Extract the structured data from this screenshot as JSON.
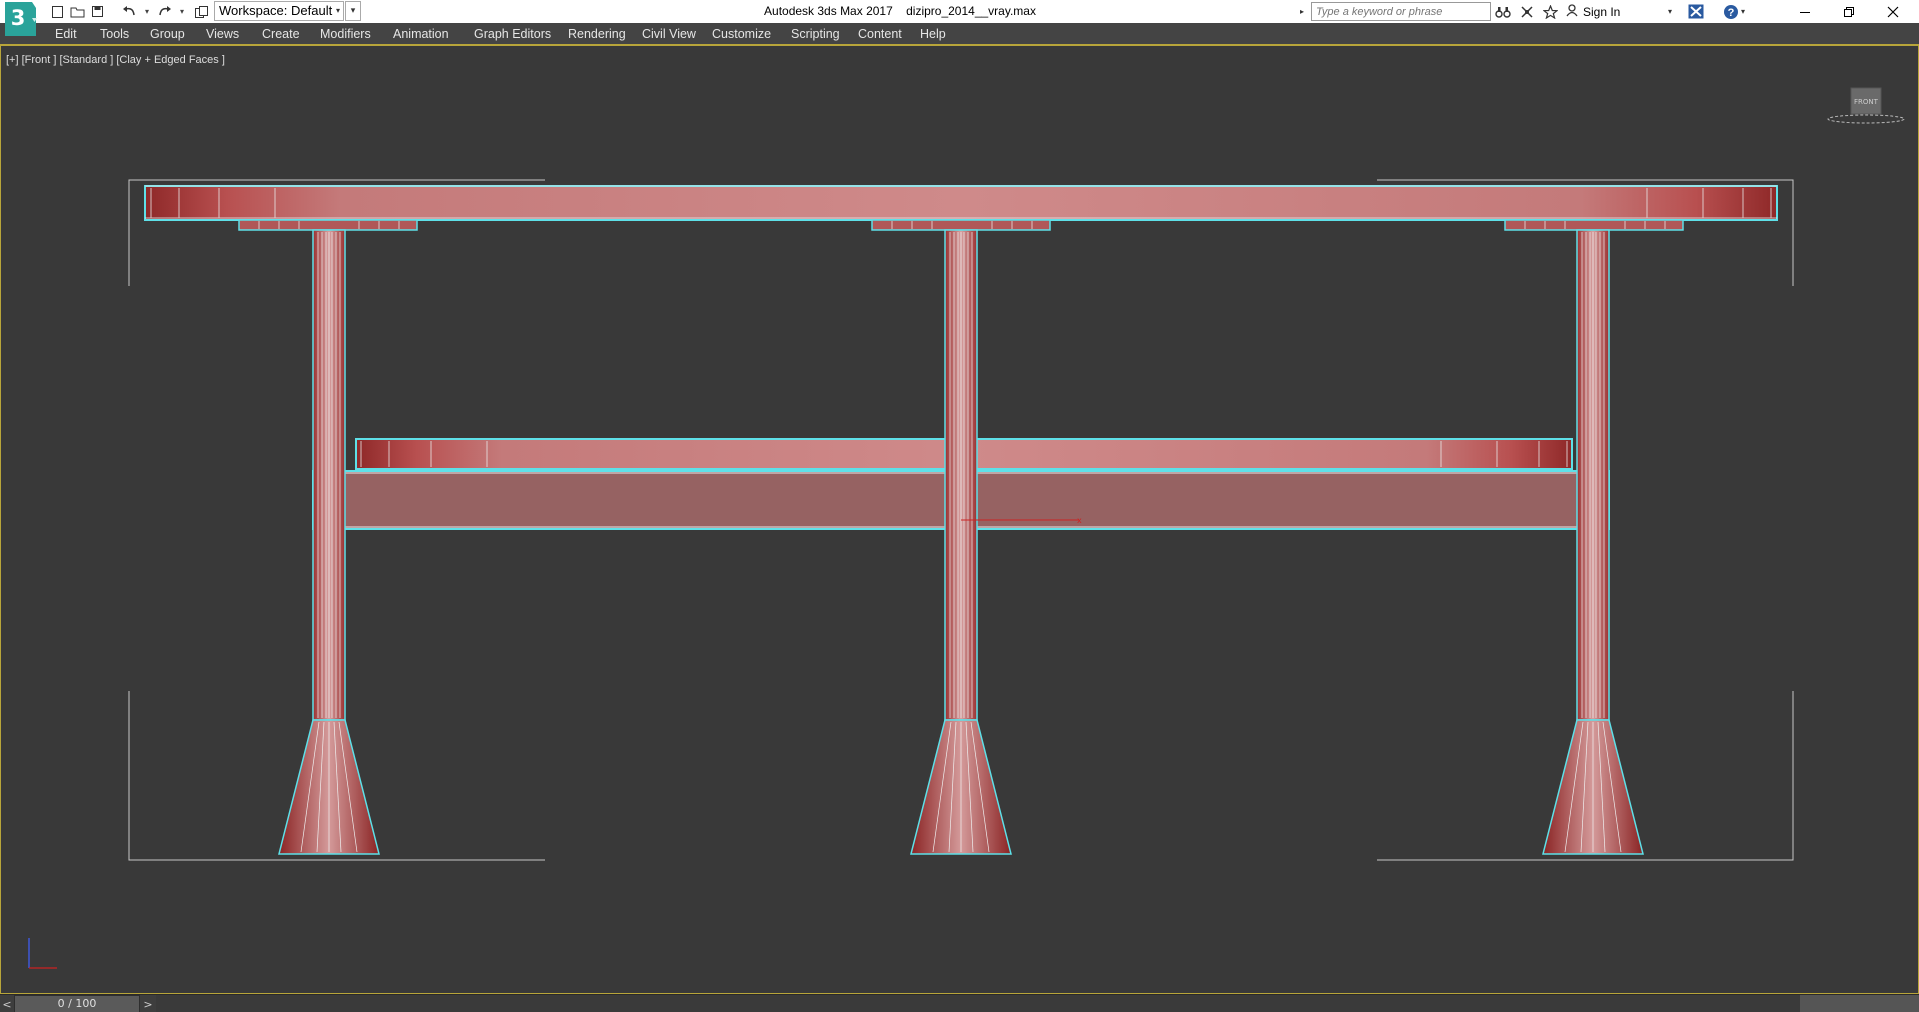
{
  "titlebar": {
    "app_name": "Autodesk 3ds Max 2017",
    "file_name": "dizipro_2014__vray.max",
    "logo_icon": "3ds-max-logo-icon",
    "logo_text": "3",
    "workspace_label": "Workspace: Default",
    "search_placeholder": "Type a keyword or phrase",
    "signin_label": "Sign In"
  },
  "quick_access": [
    {
      "name": "new-file-icon",
      "glyph": "□"
    },
    {
      "name": "open-folder-icon",
      "glyph": "⊏"
    },
    {
      "name": "save-icon",
      "glyph": "▣"
    },
    {
      "name": "undo-icon",
      "glyph": "↶"
    },
    {
      "name": "redo-icon",
      "glyph": "↷"
    },
    {
      "name": "project-folder-icon",
      "glyph": "⧉"
    }
  ],
  "menu": [
    "Edit",
    "Tools",
    "Group",
    "Views",
    "Create",
    "Modifiers",
    "Animation",
    "Graph Editors",
    "Rendering",
    "Civil View",
    "Customize",
    "Scripting",
    "Content",
    "Help"
  ],
  "viewport": {
    "label": "[+] [Front ] [Standard ] [Clay + Edged Faces ]",
    "viewcube_text": "FRONT"
  },
  "timebar": {
    "frame_readout": "0 / 100",
    "prev_glyph": "<",
    "next_glyph": ">"
  },
  "colors": {
    "accent_border": "#b8a53a",
    "viewport_bg": "#393939",
    "object_fill": "#a03c3c",
    "selection_outline": "#5ee0e8"
  }
}
